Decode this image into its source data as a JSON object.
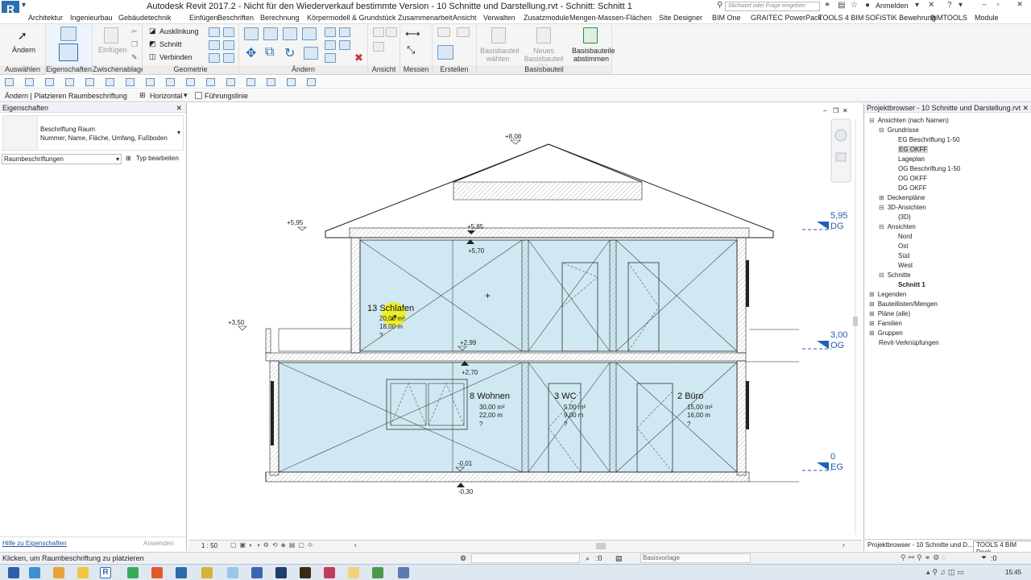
{
  "app": {
    "logo": "R",
    "title": "Autodesk Revit 2017.2 - Nicht für den Wiederverkauf bestimmte Version -     10 Schnitte und Darstellung.rvt - Schnitt: Schnitt 1",
    "search_placeholder": "Stichwort oder Frage eingeben",
    "login": "Anmelden",
    "accent": "#2a6fb5"
  },
  "menu_tabs": [
    "Architektur",
    "Ingenieurbau",
    "Gebäudetechnik",
    "Einfügen",
    "Beschriften",
    "Berechnung",
    "Körpermodell & Grundstück",
    "Zusammenarbeit",
    "Ansicht",
    "Verwalten",
    "Zusatzmodule",
    "Mengen-Massen-Flächen",
    "Site Designer",
    "BIM One",
    "GRAITEC PowerPack",
    "TOOLS 4 BIM",
    "SOFiSTiK Bewehrung",
    "BiMTOOLS",
    "Module"
  ],
  "ribbon": {
    "aendern": "Ändern",
    "einfuegen": "Einfügen",
    "ausklinkung": "Ausklinkung",
    "schnitt": "Schnitt",
    "verbinden": "Verbinden",
    "basisbauteil_waehlen": "Basisbauteil wählen",
    "neues_basisbauteil": "Neues Basisbauteil wählen",
    "basisbauteile_abstimmen": "Basisbauteile abstimmen",
    "panels": [
      "Auswählen",
      "Eigenschaften",
      "Zwischenablage",
      "Geometrie",
      "Ändern",
      "Ansicht",
      "Messen",
      "Erstellen",
      "Basisbauteil"
    ]
  },
  "optionsbar": {
    "context": "Ändern | Platzieren Raumbeschriftung",
    "orientation": "Horizontal",
    "leader_label": "Führungslinie"
  },
  "properties": {
    "title": "Eigenschaften",
    "type_name": "Beschriftung Raum",
    "type_sub": "Nummer, Name, Fläche, Umfang, Fußboden",
    "category": "Raumbeschriftungen",
    "edit_type": "Typ bearbeiten",
    "help": "Hilfe zu Eigenschaften",
    "apply": "Anwenden"
  },
  "browser": {
    "title": "Projektbrowser - 10 Schnitte und Darstellung.rvt",
    "items": [
      {
        "label": "Ansichten (nach Namen)",
        "level": 0,
        "toggle": "⊟"
      },
      {
        "label": "Grundrisse",
        "level": 1,
        "toggle": "⊟"
      },
      {
        "label": "EG Beschriftung 1-50",
        "level": 2,
        "toggle": ""
      },
      {
        "label": "EG OKFF",
        "level": 2,
        "toggle": "",
        "selected": true
      },
      {
        "label": "Lageplan",
        "level": 2,
        "toggle": ""
      },
      {
        "label": "OG Beschriftung 1-50",
        "level": 2,
        "toggle": ""
      },
      {
        "label": "OG OKFF",
        "level": 2,
        "toggle": ""
      },
      {
        "label": "DG OKFF",
        "level": 2,
        "toggle": ""
      },
      {
        "label": "Deckenpläne",
        "level": 1,
        "toggle": "⊞"
      },
      {
        "label": "3D-Ansichten",
        "level": 1,
        "toggle": "⊟"
      },
      {
        "label": "{3D}",
        "level": 2,
        "toggle": ""
      },
      {
        "label": "Ansichten",
        "level": 1,
        "toggle": "⊟"
      },
      {
        "label": "Nord",
        "level": 2,
        "toggle": ""
      },
      {
        "label": "Ost",
        "level": 2,
        "toggle": ""
      },
      {
        "label": "Süd",
        "level": 2,
        "toggle": ""
      },
      {
        "label": "West",
        "level": 2,
        "toggle": ""
      },
      {
        "label": "Schnitte",
        "level": 1,
        "toggle": "⊟"
      },
      {
        "label": "Schnitt 1",
        "level": 2,
        "toggle": "",
        "bold": true
      },
      {
        "label": "Legenden",
        "level": 0,
        "toggle": "⊞"
      },
      {
        "label": "Bauteillisten/Mengen",
        "level": 0,
        "toggle": "⊞"
      },
      {
        "label": "Pläne (alle)",
        "level": 0,
        "toggle": "⊞"
      },
      {
        "label": "Familien",
        "level": 0,
        "toggle": "⊞"
      },
      {
        "label": "Gruppen",
        "level": 0,
        "toggle": "⊞"
      },
      {
        "label": "Revit-Verknüpfungen",
        "level": 0,
        "toggle": ""
      }
    ],
    "tab_left": "Projektbrowser - 10 Schnitte und D...",
    "tab_right": "TOOLS 4 BIM Dock"
  },
  "drawing": {
    "levels": [
      {
        "value": "5,95",
        "name": "DG"
      },
      {
        "value": "3,00",
        "name": "OG"
      },
      {
        "value": "0",
        "name": "EG"
      }
    ],
    "spot_elevations": [
      "+8,08",
      "+5,95",
      "+5,85",
      "+5,70",
      "+3,50",
      "+2,99",
      "+2,70",
      "-0,01",
      "-0,30"
    ],
    "rooms": [
      {
        "number": "13",
        "name": "Schlafen",
        "area": "20,00 m²",
        "perimeter": "18,00 m",
        "extra": "?"
      },
      {
        "number": "8",
        "name": "Wohnen",
        "area": "30,00 m²",
        "perimeter": "22,00 m",
        "extra": "?"
      },
      {
        "number": "3",
        "name": "WC",
        "area": "5,00 m²",
        "perimeter": "9,00 m",
        "extra": "?"
      },
      {
        "number": "2",
        "name": "Büro",
        "area": "15,00 m²",
        "perimeter": "16,00 m",
        "extra": "?"
      }
    ],
    "room_fill": "#cfe8f2",
    "level_color": "#1f5fbf"
  },
  "viewbar": {
    "scale": "1 : 50"
  },
  "status": {
    "text": "Klicken, um Raumbeschriftung zu platzieren",
    "counter": ":0",
    "model": "Basisvorlage",
    "filter_count": ":0",
    "time": "15:45"
  }
}
